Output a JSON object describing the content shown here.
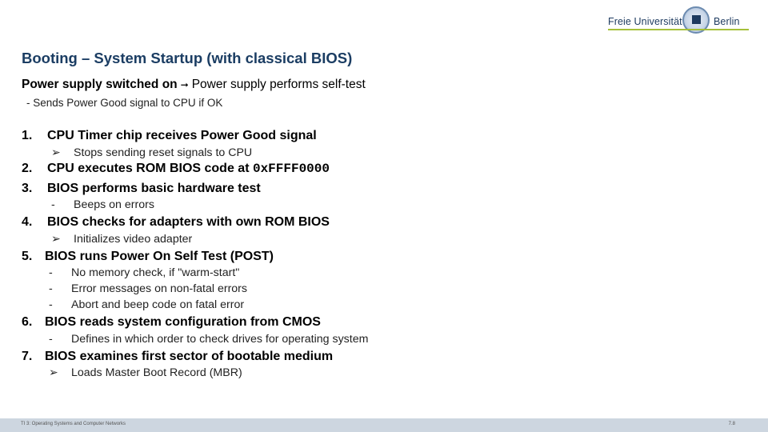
{
  "logo": {
    "left_word": "Freie Universität",
    "right_word": "Berlin"
  },
  "slide": {
    "title": "Booting – System Startup (with classical BIOS)",
    "lead_bold": "Power supply switched on",
    "lead_arrow": "➞",
    "lead_rest": "Power supply performs self-test",
    "lead_sub": "- Sends Power Good signal to CPU if OK",
    "steps": [
      {
        "num": "1.",
        "text": "CPU Timer chip receives Power Good signal",
        "bullets": [
          {
            "marker": "➢",
            "text": "Stops sending reset signals to CPU"
          }
        ]
      },
      {
        "num": "2.",
        "text": "CPU executes ROM BIOS code at ",
        "code": "0xFFFF0000",
        "bullets": []
      },
      {
        "num": "3.",
        "text": "BIOS performs basic hardware test",
        "bullets": [
          {
            "marker": "-",
            "text": "Beeps on errors"
          }
        ]
      },
      {
        "num": "4.",
        "text": "BIOS checks for adapters with own ROM BIOS",
        "bullets": [
          {
            "marker": "➢",
            "text": "Initializes video adapter"
          }
        ]
      },
      {
        "num": "5.",
        "text": "BIOS runs Power On Self Test (POST)",
        "bullets": [
          {
            "marker": "-",
            "text": "No memory check, if \"warm-start\""
          },
          {
            "marker": "-",
            "text": "Error messages on non-fatal errors"
          },
          {
            "marker": "-",
            "text": "Abort and beep code on fatal error"
          }
        ]
      },
      {
        "num": "6.",
        "text": "BIOS reads system configuration from CMOS",
        "bullets": [
          {
            "marker": "-",
            "text": "Defines in which order to check drives for operating system"
          }
        ]
      },
      {
        "num": "7.",
        "text": "BIOS examines first sector of bootable medium",
        "bullets": [
          {
            "marker": "➢",
            "text": "Loads Master Boot Record (MBR)"
          }
        ]
      }
    ]
  },
  "footer": {
    "course": "TI 3: Operating Systems and Computer Networks",
    "page": "7.8"
  }
}
